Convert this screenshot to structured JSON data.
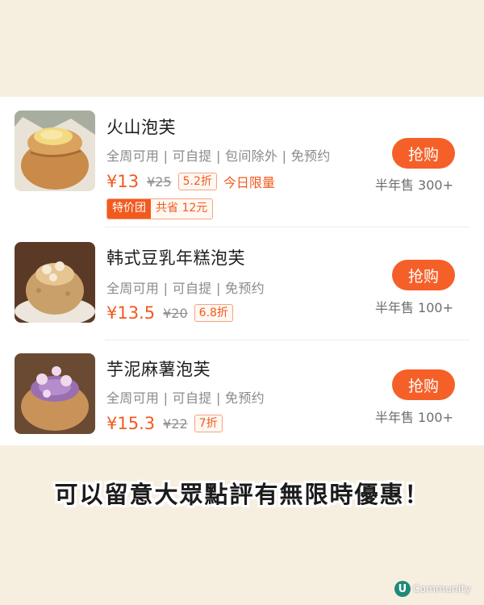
{
  "deals": [
    {
      "name": "火山泡芙",
      "tags": "全周可用 | 可自提 | 包间除外 | 免预约",
      "price": "¥13",
      "original_price": "¥25",
      "discount": "5.2折",
      "limit": "今日限量",
      "group_badge": "特价团",
      "group_save": "共省 12元",
      "buy_label": "抢购",
      "sold": "半年售 300+",
      "image": "volcano-puff-photo"
    },
    {
      "name": "韩式豆乳年糕泡芙",
      "tags": "全周可用 | 可自提 | 免预约",
      "price": "¥13.5",
      "original_price": "¥20",
      "discount": "6.8折",
      "buy_label": "抢购",
      "sold": "半年售 100+",
      "image": "soy-milk-rice-cake-puff-photo"
    },
    {
      "name": "芋泥麻薯泡芙",
      "tags": "全周可用 | 可自提 | 免预约",
      "price": "¥15.3",
      "original_price": "¥22",
      "discount": "7折",
      "buy_label": "抢购",
      "sold": "半年售 100+",
      "image": "taro-mochi-puff-photo"
    }
  ],
  "caption": "可以留意大眾點評有無限時優惠！",
  "brand": {
    "logo": "U",
    "text": "Community"
  },
  "colors": {
    "accent": "#f2591f",
    "button": "#f56028",
    "background": "#f6efe0"
  }
}
